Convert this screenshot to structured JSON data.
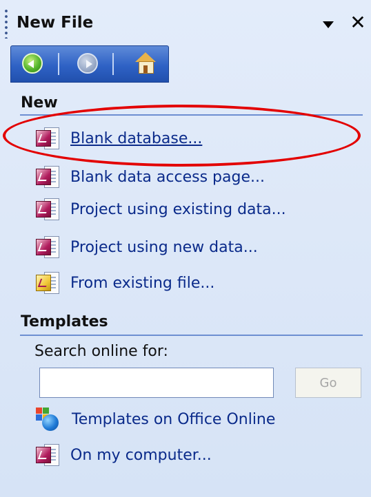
{
  "header": {
    "title": "New File"
  },
  "nav": {
    "back_icon": "back-arrow-icon",
    "forward_icon": "forward-arrow-icon",
    "home_icon": "home-icon"
  },
  "sections": {
    "new": {
      "heading": "New",
      "items": [
        {
          "label": "Blank database...",
          "icon": "database-icon"
        },
        {
          "label": "Blank data access page...",
          "icon": "data-access-page-icon"
        },
        {
          "label": "Project using existing data...",
          "icon": "project-existing-data-icon"
        },
        {
          "label": "Project using new data...",
          "icon": "project-new-data-icon"
        },
        {
          "label": "From existing file...",
          "icon": "existing-file-icon"
        }
      ]
    },
    "templates": {
      "heading": "Templates",
      "search_label": "Search online for:",
      "search_value": "",
      "go_label": "Go",
      "links": [
        {
          "label": "Templates on Office Online",
          "icon": "office-online-icon"
        },
        {
          "label": "On my computer...",
          "icon": "computer-templates-icon"
        }
      ]
    }
  },
  "colors": {
    "annotation": "#e30000",
    "link": "#0a2a8a",
    "pane_bg": "#d7e4f7",
    "nav_bar": "#2f62c5"
  }
}
